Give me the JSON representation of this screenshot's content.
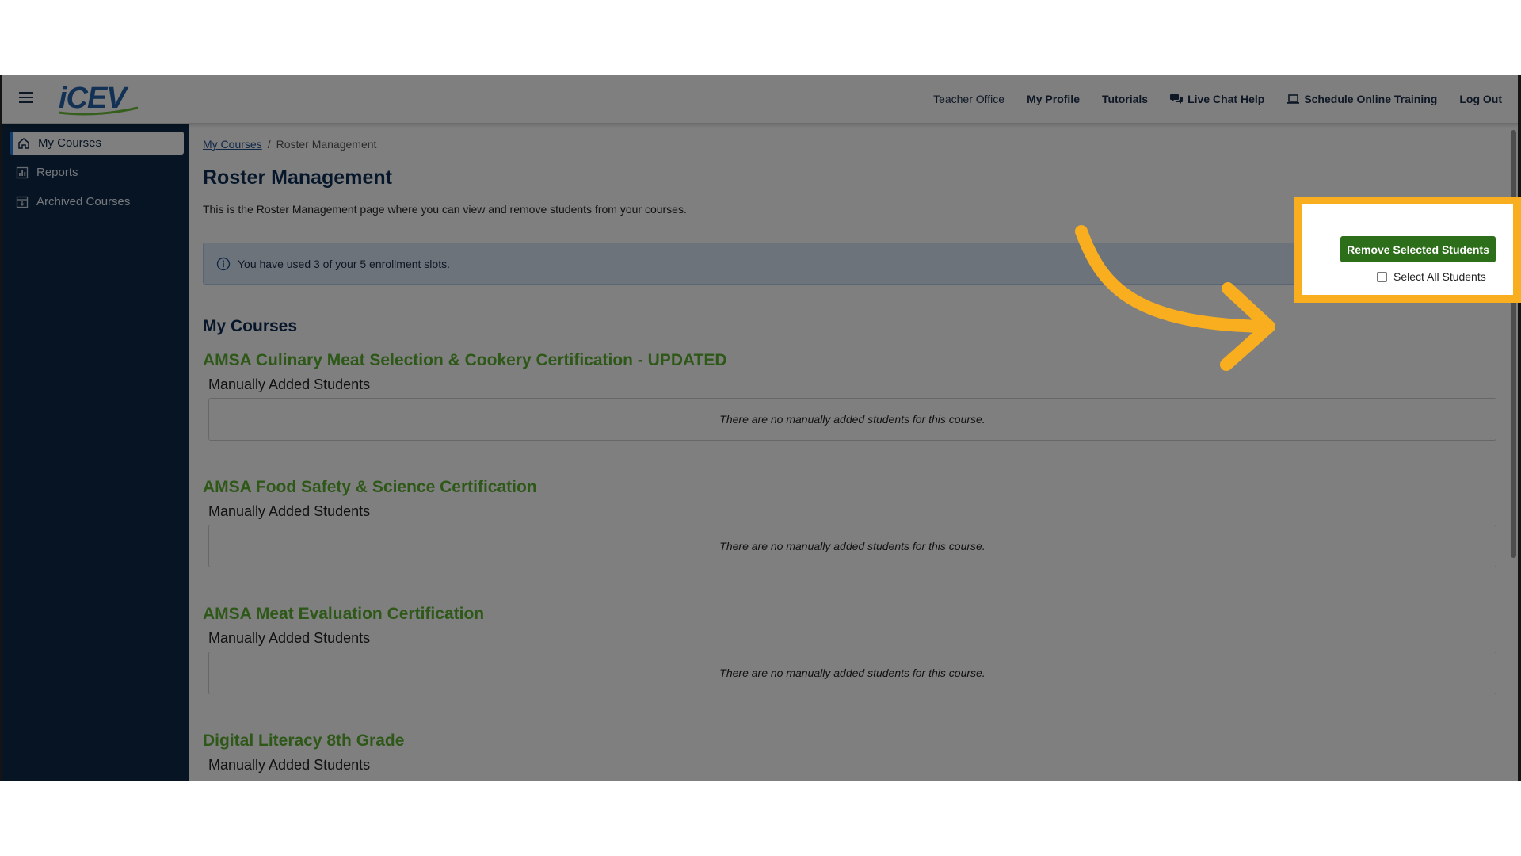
{
  "header": {
    "logo_text": "iCEV",
    "nav": [
      {
        "label": "Teacher Office"
      },
      {
        "label": "My Profile"
      },
      {
        "label": "Tutorials"
      },
      {
        "label": "Live Chat Help"
      },
      {
        "label": "Schedule Online Training"
      },
      {
        "label": "Log Out"
      }
    ]
  },
  "sidebar": {
    "items": [
      {
        "label": "My Courses",
        "icon": "home-icon",
        "active": true
      },
      {
        "label": "Reports",
        "icon": "chart-icon",
        "active": false
      },
      {
        "label": "Archived Courses",
        "icon": "archive-icon",
        "active": false
      }
    ]
  },
  "breadcrumb": {
    "link": "My Courses",
    "separator": "/",
    "current": "Roster Management"
  },
  "page": {
    "title": "Roster Management",
    "description": "This is the Roster Management page where you can view and remove students from your courses.",
    "alert": "You have used 3 of your 5 enrollment slots.",
    "section_title": "My Courses",
    "remove_button": "Remove Selected Students",
    "select_all_label": "Select All Students"
  },
  "courses": [
    {
      "name": "AMSA Culinary Meat Selection & Cookery Certification - UPDATED",
      "subheading": "Manually Added Students",
      "empty_text": "There are no manually added students for this course."
    },
    {
      "name": "AMSA Food Safety & Science Certification",
      "subheading": "Manually Added Students",
      "empty_text": "There are no manually added students for this course."
    },
    {
      "name": "AMSA Meat Evaluation Certification",
      "subheading": "Manually Added Students",
      "empty_text": "There are no manually added students for this course."
    },
    {
      "name": "Digital Literacy 8th Grade",
      "subheading": "Manually Added Students",
      "empty_text": ""
    }
  ],
  "colors": {
    "sidebar_bg": "#0e2947",
    "course_title": "#5cb030",
    "button_green": "#2d6e1a",
    "highlight": "#f8ae1f"
  }
}
